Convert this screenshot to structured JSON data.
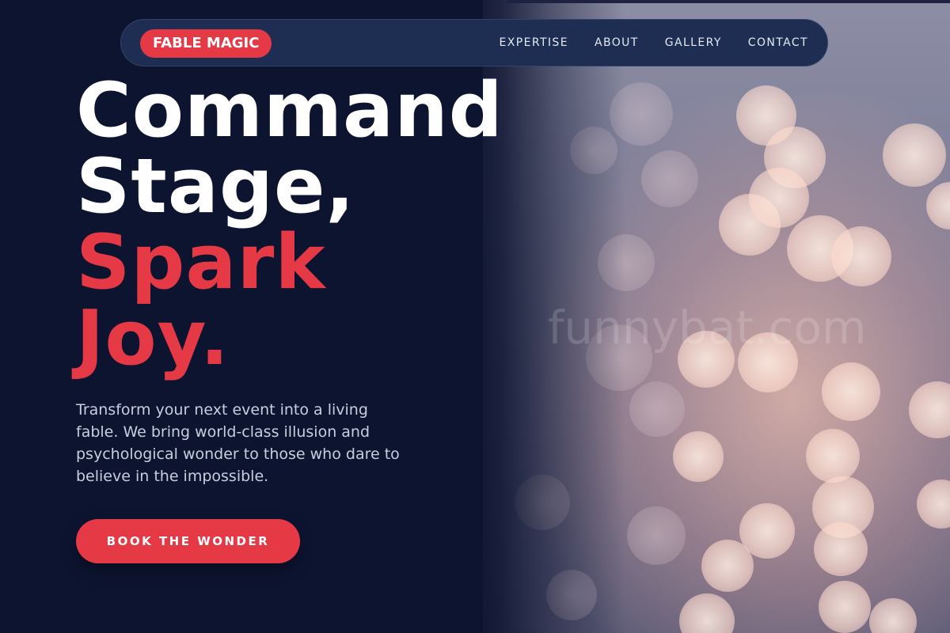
{
  "brand": {
    "logo_text": "FABLE MAGIC"
  },
  "nav": {
    "items": [
      {
        "label": "EXPERTISE"
      },
      {
        "label": "ABOUT"
      },
      {
        "label": "GALLERY"
      },
      {
        "label": "CONTACT"
      }
    ]
  },
  "hero": {
    "headline_lines": [
      {
        "text": "Command"
      },
      {
        "text": "Stage,"
      },
      {
        "text": "Spark"
      },
      {
        "text": "Joy."
      }
    ],
    "intro": "Transform your next event into a living fable. We bring world-class illusion and psychological wonder to those who dare to believe in the impossible.",
    "cta_label": "BOOK THE WONDER"
  },
  "background": {
    "watermark_text": "funnybat.com"
  },
  "colors": {
    "navy_background": "#0d1430",
    "navbar": "#1e2d52",
    "accent_red": "#e63946",
    "headline_white": "#ffffff",
    "intro_text": "#c8cede"
  }
}
